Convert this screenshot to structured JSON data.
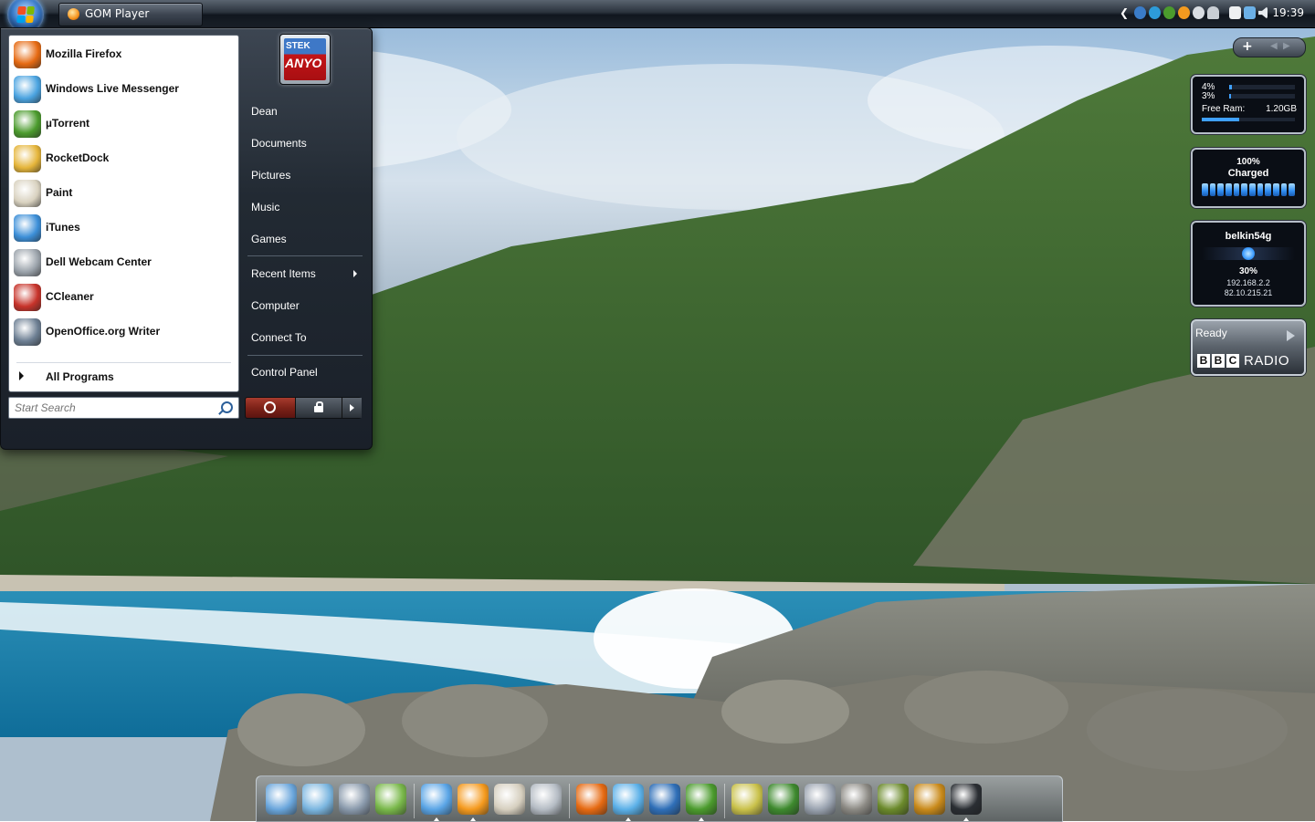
{
  "taskbar": {
    "start_button": "Start",
    "task_label": "GOM Player",
    "clock": "19:39",
    "tray_icons": [
      "network-icon",
      "update-icon",
      "utorrent-icon",
      "gom-icon",
      "steam-icon",
      "user-icon",
      "flag-icon",
      "monitor-icon",
      "volume-icon"
    ]
  },
  "start_menu": {
    "programs": [
      {
        "label": "Mozilla Firefox",
        "icon": "firefox-icon",
        "color": "#e66a12"
      },
      {
        "label": "Windows Live Messenger",
        "icon": "messenger-icon",
        "color": "#4aa3e0"
      },
      {
        "label": "µTorrent",
        "icon": "utorrent-icon",
        "color": "#4b9b2d"
      },
      {
        "label": "RocketDock",
        "icon": "rocketdock-icon",
        "color": "#e5b53a"
      },
      {
        "label": "Paint",
        "icon": "paint-icon",
        "color": "#d9d2c0"
      },
      {
        "label": "iTunes",
        "icon": "itunes-icon",
        "color": "#3c8fd8"
      },
      {
        "label": "Dell Webcam Center",
        "icon": "webcam-icon",
        "color": "#9ba3ab"
      },
      {
        "label": "CCleaner",
        "icon": "ccleaner-icon",
        "color": "#c7332a"
      },
      {
        "label": "OpenOffice.org Writer",
        "icon": "writer-icon",
        "color": "#6d7f93"
      }
    ],
    "all_programs": "All Programs",
    "search_placeholder": "Start Search",
    "user_picture": {
      "line1": "STEK",
      "line2": "ANYO"
    },
    "right_items": {
      "user": "Dean",
      "documents": "Documents",
      "pictures": "Pictures",
      "music": "Music",
      "games": "Games",
      "recent": "Recent Items",
      "computer": "Computer",
      "connect": "Connect To",
      "control": "Control Panel"
    }
  },
  "gadgets": {
    "cpu": {
      "core1": "4%",
      "core2": "3%",
      "core1_value": 0.04,
      "core2_value": 0.03,
      "ram_label": "Free Ram:",
      "ram_value": "1.20GB",
      "ram_used": 0.4
    },
    "battery": {
      "percent": "100%",
      "status": "Charged"
    },
    "wifi": {
      "ssid": "belkin54g",
      "signal": "30%",
      "ip1": "192.168.2.2",
      "ip2": "82.10.215.21"
    },
    "radio": {
      "status": "Ready",
      "brand": "BBC",
      "label": "RADIO"
    }
  },
  "dock": {
    "icons": [
      "computer-icon",
      "documents-icon",
      "explorer-icon",
      "excel-icon",
      "itunes-icon",
      "gom-icon",
      "paint-icon",
      "webcam-icon",
      "firefox-icon",
      "messenger-icon",
      "google-earth-icon",
      "utorrent-icon",
      "trophy-icon",
      "game-4-icon",
      "halo-icon",
      "battlefield-icon",
      "halflife-icon",
      "unreal-icon",
      "steam-icon"
    ]
  }
}
